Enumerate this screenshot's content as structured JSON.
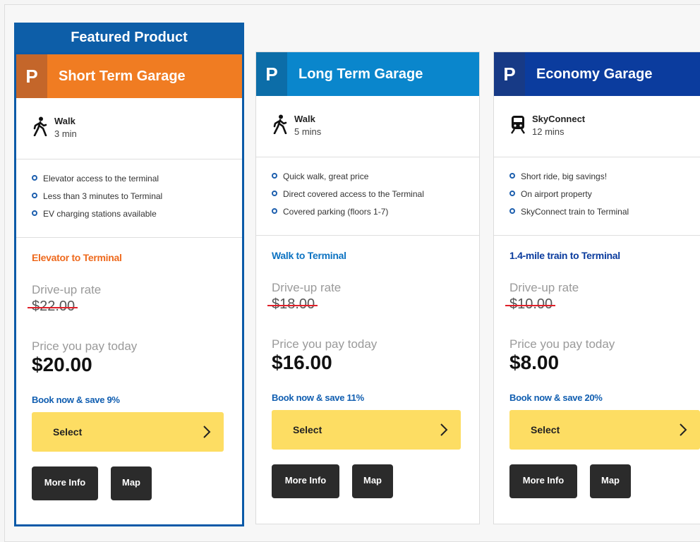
{
  "featured_banner": "Featured Product",
  "colors": {
    "featured_border": "#0a5aa8",
    "short_term_header": "#f07c22",
    "long_term_header": "#0a86cc",
    "economy_header": "#0b3c9e",
    "select_button": "#fddd63",
    "action_button": "#2b2b2b",
    "link_blue": "#0f5db0",
    "strike_red": "#e0202a"
  },
  "cards": [
    {
      "p_label": "P",
      "title": "Short Term Garage",
      "mode_icon": "walk-icon",
      "mode_label": "Walk",
      "mode_time": "3 min",
      "features": [
        "Elevator access to the terminal",
        "Less than 3 minutes to Terminal",
        "EV charging stations available"
      ],
      "transit": "Elevator to Terminal",
      "drive_label": "Drive-up rate",
      "old_price": "$22.00",
      "pay_label": "Price you pay today",
      "price": "$20.00",
      "save": "Book now & save 9%",
      "select_label": "Select",
      "more_info": "More Info",
      "map": "Map"
    },
    {
      "p_label": "P",
      "title": "Long Term Garage",
      "mode_icon": "walk-icon",
      "mode_label": "Walk",
      "mode_time": "5 mins",
      "features": [
        "Quick walk, great price",
        "Direct covered access to the Terminal",
        "Covered parking (floors 1-7)"
      ],
      "transit": "Walk to Terminal",
      "drive_label": "Drive-up rate",
      "old_price": "$18.00",
      "pay_label": "Price you pay today",
      "price": "$16.00",
      "save": "Book now & save 11%",
      "select_label": "Select",
      "more_info": "More Info",
      "map": "Map"
    },
    {
      "p_label": "P",
      "title": "Economy Garage",
      "mode_icon": "train-icon",
      "mode_label": "SkyConnect",
      "mode_time": "12 mins",
      "features": [
        "Short ride, big savings!",
        "On airport property",
        "SkyConnect train to Terminal"
      ],
      "transit": "1.4-mile train to Terminal",
      "drive_label": "Drive-up rate",
      "old_price": "$10.00",
      "pay_label": "Price you pay today",
      "price": "$8.00",
      "save": "Book now & save 20%",
      "select_label": "Select",
      "more_info": "More Info",
      "map": "Map"
    }
  ]
}
